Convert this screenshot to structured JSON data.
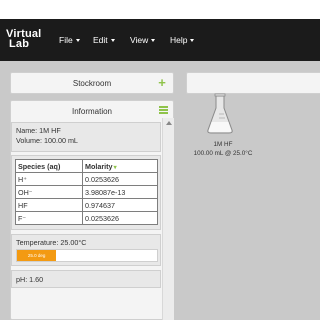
{
  "app": {
    "logo_line1": "Virtual",
    "logo_line2": "Lab"
  },
  "menu": {
    "items": [
      {
        "label": "File"
      },
      {
        "label": "Edit"
      },
      {
        "label": "View"
      },
      {
        "label": "Help"
      }
    ]
  },
  "stockroom": {
    "title": "Stockroom",
    "icon": "plus-icon"
  },
  "information": {
    "title": "Information",
    "icon": "menu-icon",
    "solution": {
      "name": "Name: 1M HF",
      "volume": "Volume: 100.00 mL"
    },
    "species_table": {
      "headers": [
        "Species (aq)",
        "Molarity"
      ],
      "rows": [
        {
          "species": "H⁺",
          "molarity": "0.0253626"
        },
        {
          "species": "OH⁻",
          "molarity": "3.98087e-13"
        },
        {
          "species": "HF",
          "molarity": "0.974637"
        },
        {
          "species": "F⁻",
          "molarity": "0.0253626"
        }
      ]
    },
    "temperature": {
      "label": "Temperature: 25.00°C",
      "bar_label": "25.0 deg",
      "fill_fraction": 0.28,
      "bar_color": "#f39a12"
    },
    "ph": "pH: 1.60"
  },
  "workbench": {
    "flask": {
      "icon": "erlenmeyer-flask-icon",
      "name": "1M HF",
      "details": "100.00 mL @ 25.0°C"
    }
  },
  "colors": {
    "navbar": "#1b1b1b",
    "accent_green": "#8fc34a",
    "workspace": "#c9c9c9"
  }
}
